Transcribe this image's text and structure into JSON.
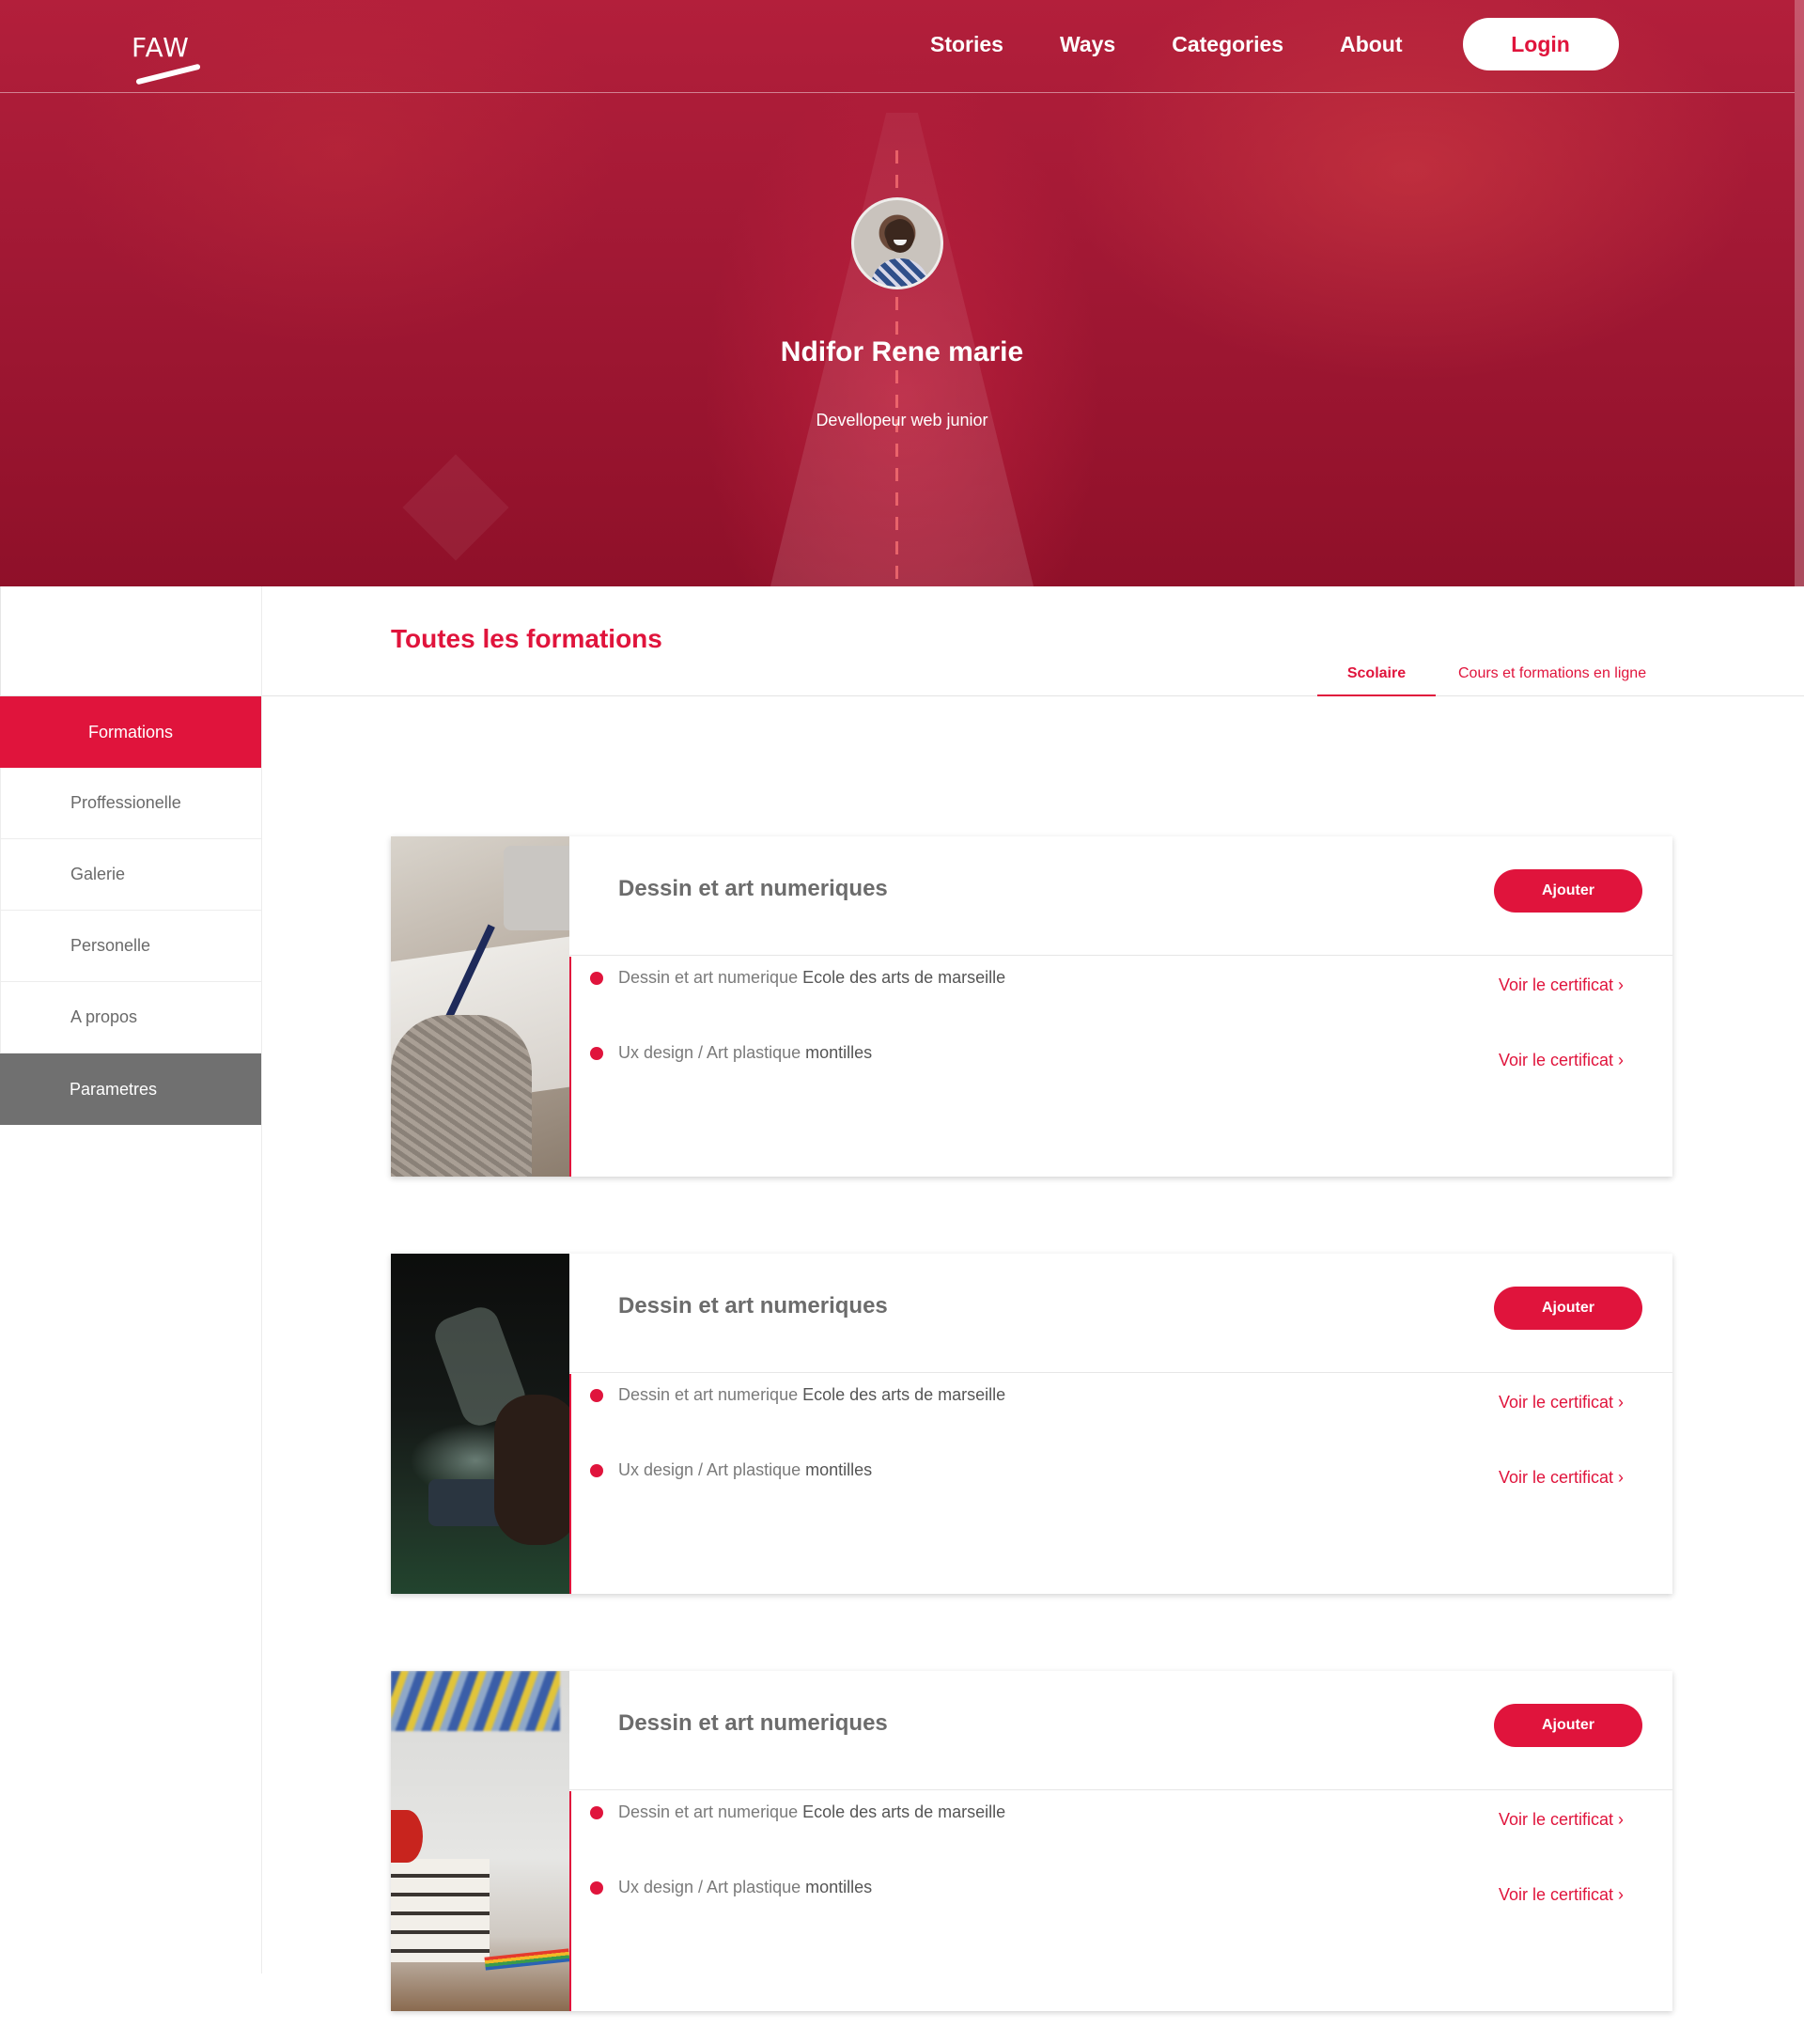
{
  "brand": {
    "logo_text": "FAW"
  },
  "nav": {
    "links": [
      "Stories",
      "Ways",
      "Categories",
      "About"
    ],
    "login_label": "Login"
  },
  "profile": {
    "name": "Ndifor Rene marie",
    "role": "Devellopeur web junior"
  },
  "sidebar": {
    "items": [
      {
        "label": "Formations",
        "state": "active"
      },
      {
        "label": "Proffessionelle"
      },
      {
        "label": "Galerie"
      },
      {
        "label": "Personelle"
      },
      {
        "label": "A propos"
      },
      {
        "label": "Parametres",
        "state": "dark"
      }
    ]
  },
  "main": {
    "title": "Toutes les formations",
    "tabs": [
      {
        "label": "Scolaire",
        "active": true
      },
      {
        "label": "Cours et formations en ligne"
      }
    ],
    "cards": [
      {
        "title": "Dessin et art numeriques",
        "add_label": "Ajouter",
        "rows": [
          {
            "text": "Dessin et art numerique",
            "strong": "Ecole des arts de marseille",
            "cert": "Voir le certificat ›"
          },
          {
            "text": "Ux design / Art plastique",
            "strong": "montilles",
            "cert": "Voir le certificat ›"
          }
        ]
      },
      {
        "title": "Dessin et art numeriques",
        "add_label": "Ajouter",
        "rows": [
          {
            "text": "Dessin et art numerique",
            "strong": "Ecole des arts de marseille",
            "cert": "Voir le certificat ›"
          },
          {
            "text": "Ux design / Art plastique",
            "strong": "montilles",
            "cert": "Voir le certificat ›"
          }
        ]
      },
      {
        "title": "Dessin et art numeriques",
        "add_label": "Ajouter",
        "rows": [
          {
            "text": "Dessin et art numerique",
            "strong": "Ecole des arts de marseille",
            "cert": "Voir le certificat ›"
          },
          {
            "text": "Ux design / Art plastique",
            "strong": "montilles",
            "cert": "Voir le certificat ›"
          }
        ]
      }
    ]
  },
  "colors": {
    "accent": "#e0143c",
    "hero": "#a11834",
    "sidebar_dark": "#707070",
    "text_muted": "#6a6a6a"
  }
}
